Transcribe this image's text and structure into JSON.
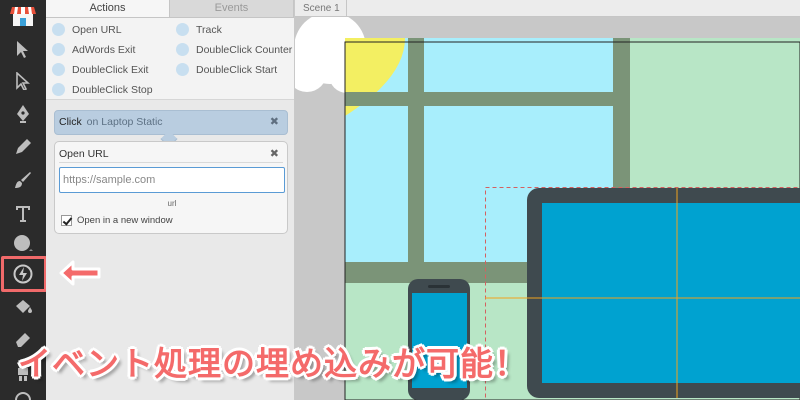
{
  "panel": {
    "tabs": [
      "Actions",
      "Events"
    ],
    "actions_left": [
      "Open URL",
      "AdWords Exit",
      "DoubleClick Exit",
      "DoubleClick Stop"
    ],
    "actions_right": [
      "Track",
      "DoubleClick Counter",
      "DoubleClick Start"
    ]
  },
  "event": {
    "trigger": "Click",
    "target": "on Laptop Static",
    "close": "✖"
  },
  "open_url": {
    "title": "Open URL",
    "close": "✖",
    "input_placeholder": "https://sample.com",
    "input_caption": "url",
    "new_window_label": "Open in a new window",
    "new_window_checked": true
  },
  "stage": {
    "scene_tab": "Scene 1"
  },
  "toolbar": {
    "icons": [
      "store-icon",
      "select-arrow-icon",
      "direct-select-icon",
      "pen-icon",
      "pencil-icon",
      "brush-icon",
      "text-icon",
      "ellipse-icon",
      "event-lightning-icon",
      "fill-bucket-icon",
      "eraser-icon",
      "puppet-icon",
      "rotate-icon"
    ],
    "highlighted_tool": "event-lightning-icon"
  },
  "caption": {
    "text": "イベント処理の埋め込みが可能！"
  },
  "colors": {
    "highlight_red": "#f06a6a",
    "caption_red": "#f46a6a",
    "screen_blue": "#00a2d0",
    "sky_blue": "#a8eefc",
    "grid_green": "#7b9478",
    "mint": "#b8e6c6"
  }
}
